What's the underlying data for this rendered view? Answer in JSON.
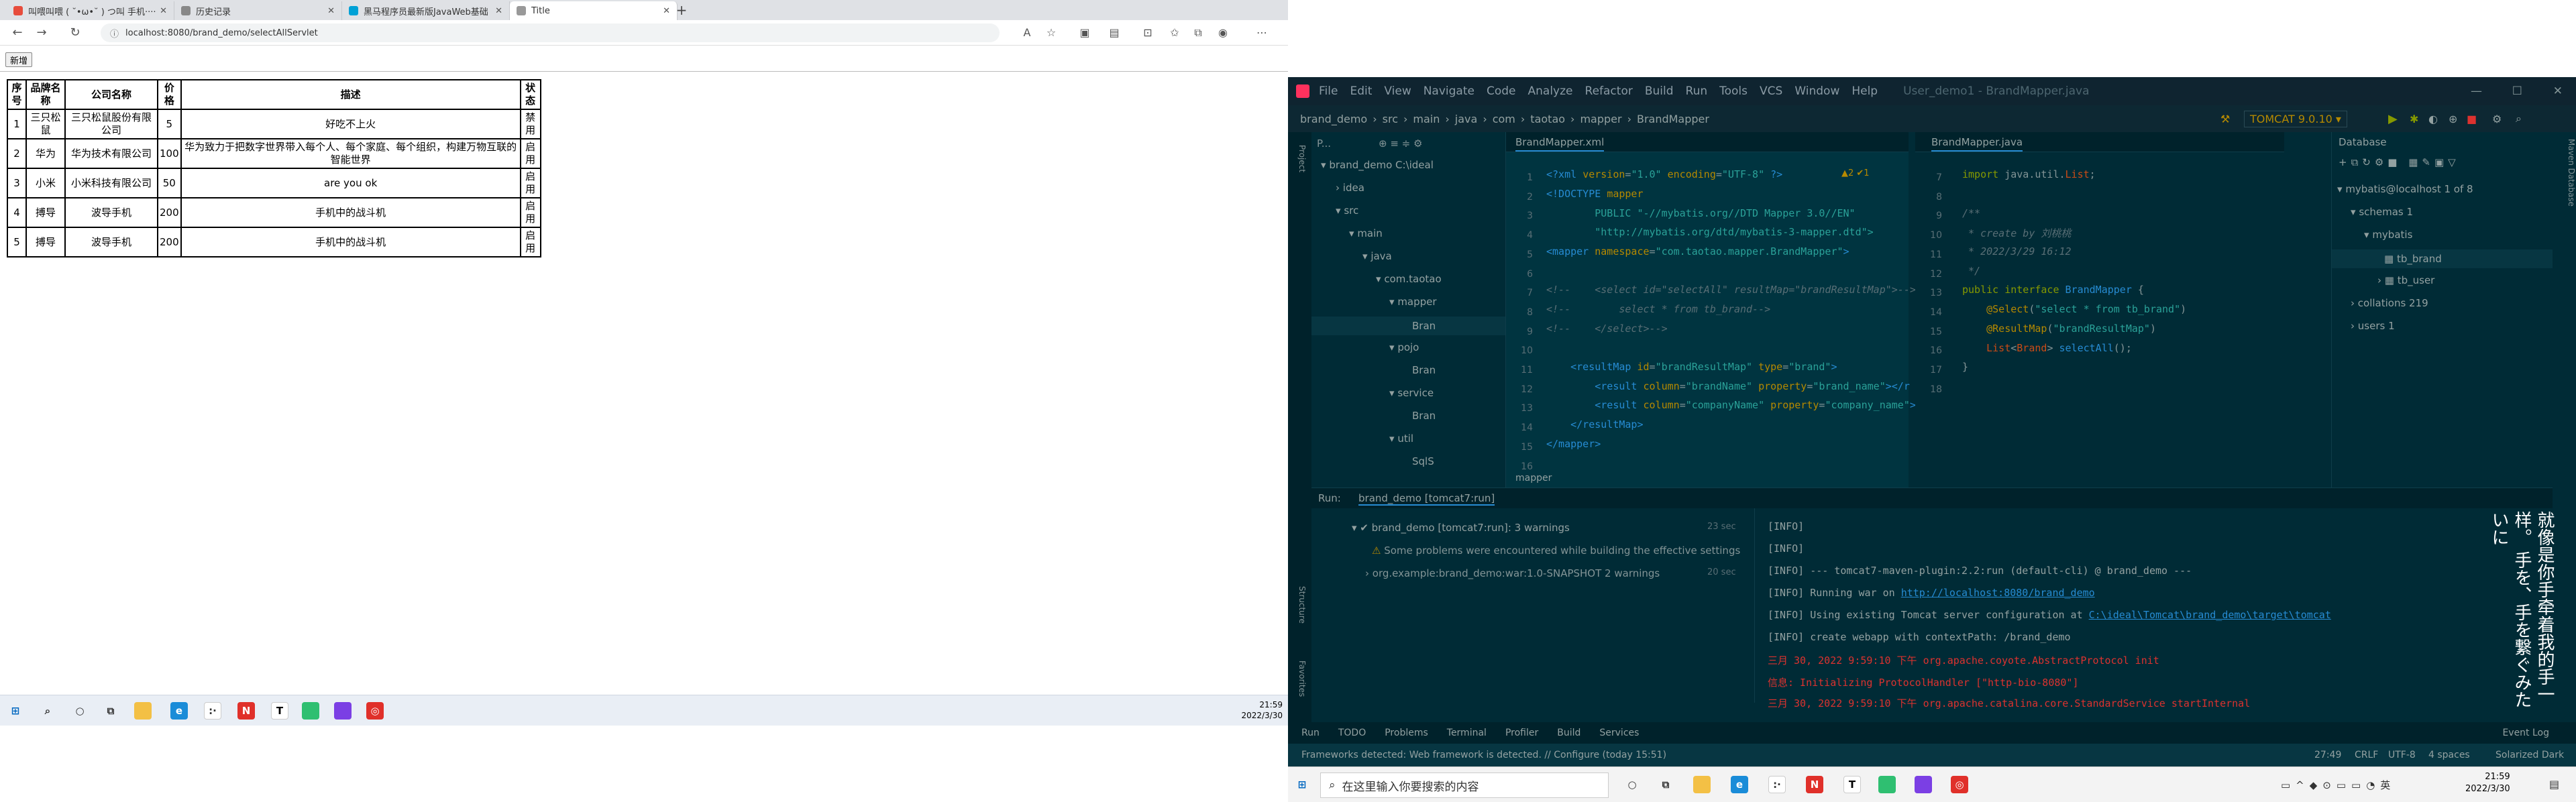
{
  "browser": {
    "tabs": [
      {
        "label": "叫喂叫喂 ( ˘•ω•˘ ) つ叫 手机···· 山山",
        "color": "#e74c3c"
      },
      {
        "label": "历史记录",
        "color": "#888"
      },
      {
        "label": "黑马程序员最新版JavaWeb基础",
        "color": "#00a1d6"
      },
      {
        "label": "Title",
        "color": "#999"
      }
    ],
    "url": "localhost:8080/brand_demo/selectAllServlet",
    "add_button": "新增",
    "table": {
      "headers": [
        "序号",
        "品牌名称",
        "公司名称",
        "价格",
        "描述",
        "状态"
      ],
      "rows": [
        [
          "1",
          "三只松鼠",
          "三只松鼠股份有限公司",
          "5",
          "好吃不上火",
          "禁用"
        ],
        [
          "2",
          "华为",
          "华为技术有限公司",
          "100",
          "华为致力于把数字世界带入每个人、每个家庭、每个组织，构建万物互联的智能世界",
          "启用"
        ],
        [
          "3",
          "小米",
          "小米科技有限公司",
          "50",
          "are you ok",
          "启用"
        ],
        [
          "4",
          "搏导",
          "波导手机",
          "200",
          "手机中的战斗机",
          "启用"
        ],
        [
          "5",
          "搏导",
          "波导手机",
          "200",
          "手机中的战斗机",
          "启用"
        ]
      ]
    },
    "clock": {
      "time": "21:59",
      "date": "2022/3/30"
    }
  },
  "ide": {
    "window_title": "User_demo1 - BrandMapper.java",
    "menus": [
      "File",
      "Edit",
      "View",
      "Navigate",
      "Code",
      "Analyze",
      "Refactor",
      "Build",
      "Run",
      "Tools",
      "VCS",
      "Window",
      "Help"
    ],
    "breadcrumb": [
      "brand_demo",
      "src",
      "main",
      "java",
      "com",
      "taotao",
      "mapper",
      "BrandMapper"
    ],
    "run_config": "TOMCAT 9.0.10",
    "editor_left": {
      "tab": "BrandMapper.xml",
      "footer": "mapper",
      "warnings": "▲2  ✔1"
    },
    "editor_right": {
      "tab": "BrandMapper.java"
    },
    "project_label": "P...",
    "project_tree": [
      "brand_demo  C:\\ideal",
      "idea",
      "src",
      "main",
      "java",
      "com.taotao",
      "mapper",
      "Bran",
      "pojo",
      "Bran",
      "service",
      "Bran",
      "util",
      "SqlS"
    ],
    "db": {
      "title": "Database",
      "items": [
        "mybatis@localhost  1 of 8",
        "schemas  1",
        "mybatis",
        "tb_brand",
        "tb_user",
        "collations  219",
        "users  1"
      ]
    },
    "run": {
      "label": "Run:",
      "config": "brand_demo [tomcat7:run]",
      "tree": [
        "brand_demo [tomcat7:run]:  3 warnings",
        "Some problems were encountered while building the effective settings",
        "org.example:brand_demo:war:1.0-SNAPSHOT  2 warnings"
      ],
      "times": [
        "23 sec",
        "20 sec"
      ],
      "log": [
        "[INFO]",
        "[INFO]",
        "[INFO] --- tomcat7-maven-plugin:2.2:run (default-cli) @ brand_demo ---",
        "[INFO] Running war on ",
        "[INFO] Using existing Tomcat server configuration at ",
        "[INFO] create webapp with contextPath: /brand_demo",
        "三月 30, 2022 9:59:10 下午 org.apache.coyote.AbstractProtocol init",
        "信息: Initializing ProtocolHandler [\"http-bio-8080\"]",
        "三月 30, 2022 9:59:10 下午 org.apache.catalina.core.StandardService startInternal"
      ],
      "link1": "http://localhost:8080/brand_demo",
      "link2": "C:\\ideal\\Tomcat\\brand_demo\\target\\tomcat"
    },
    "bottom_tabs": [
      "Run",
      "TODO",
      "Problems",
      "Terminal",
      "Profiler",
      "Build",
      "Services"
    ],
    "event_log": "Event Log",
    "status": {
      "message": "Frameworks detected: Web framework is detected. // Configure (today 15:51)",
      "position": "27:49",
      "line_sep": "CRLF",
      "encoding": "UTF-8",
      "indent": "4 spaces",
      "theme": "Solarized Dark"
    },
    "taskbar": {
      "search": "在这里输入你要搜索的内容",
      "time": "21:59",
      "date": "2022/3/30"
    },
    "overlay_text": "就像是你手牵着我的手一样。 手を、手を繋ぐみたいに"
  }
}
